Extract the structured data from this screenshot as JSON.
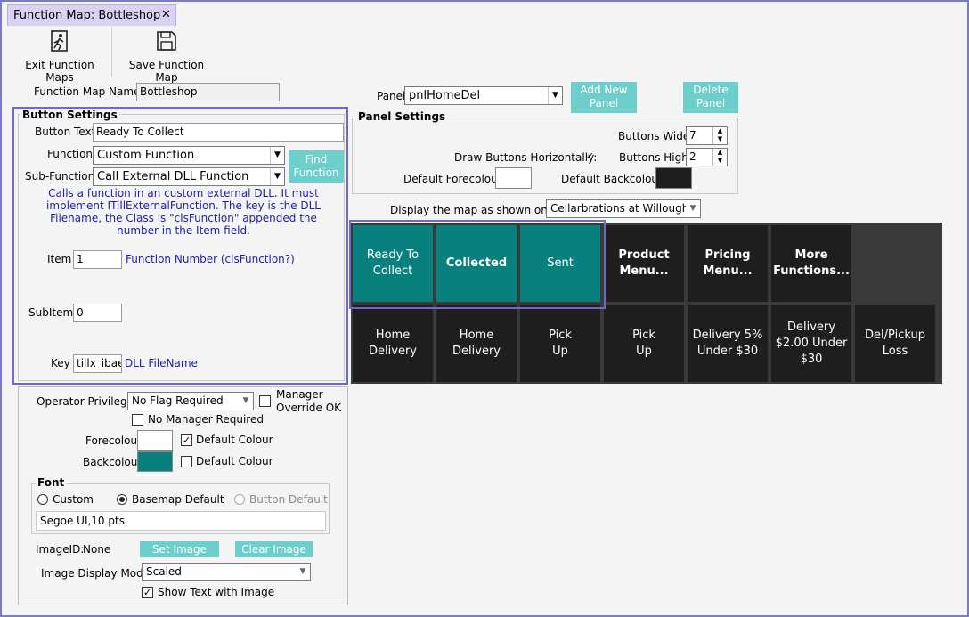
{
  "tab": {
    "title": "Function Map: Bottleshop",
    "close": "✕"
  },
  "toolbar": {
    "exit_label": "Exit Function Maps",
    "save_label": "Save Function Map"
  },
  "function_map_name": {
    "label": "Function Map Name:",
    "value": "Bottleshop"
  },
  "panel": {
    "label": "Panel",
    "value": "pnlHomeDel",
    "add_button": "Add New\nPanel",
    "delete_button": "Delete\nPanel"
  },
  "panel_settings": {
    "title": "Panel Settings",
    "buttons_wide_label": "Buttons Wide:",
    "buttons_wide": "7",
    "buttons_high_label": "Buttons High:",
    "buttons_high": "2",
    "draw_horiz_label": "Draw Buttons Horizontally:",
    "draw_horiz_checked": true,
    "forecolour_label": "Default Forecolour",
    "backcolour_label": "Default Backcolour",
    "forecolour": "#ffffff",
    "backcolour": "#1e1e1e"
  },
  "display_map": {
    "label": "Display the map as shown on till:",
    "value": "Cellarbrations at Willoughb"
  },
  "button_settings": {
    "title": "Button Settings",
    "button_text_label": "Button Text",
    "button_text": "Ready To Collect",
    "function_label": "Function",
    "function_value": "Custom Function",
    "subfunction_label": "Sub-Function",
    "subfunction_value": "Call External DLL Function",
    "find_button": "Find\nFunction",
    "description": "Calls a function in an custom external DLL. It must implement ITillExternalFunction. The key is the DLL Filename, the Class is \"clsFunction\" appended the number in the Item field.",
    "item_label": "Item",
    "item_value": "1",
    "item_hint": "Function Number (clsFunction?)",
    "subitem_label": "SubItem",
    "subitem_value": "0",
    "key_label": "Key",
    "key_value": "tillx_ibaec",
    "key_hint": "DLL FileName"
  },
  "operator": {
    "label": "Operator Privilege:",
    "value": "No Flag Required",
    "manager_override": "Manager\nOverride OK",
    "no_manager": "No Manager Required"
  },
  "colours": {
    "forecolour_label": "Forecolour",
    "backcolour_label": "Backcolour",
    "default_colour": "Default Colour",
    "forecolour": "#ffffff",
    "backcolour": "#08807d",
    "fore_default_checked": true,
    "back_default_checked": false
  },
  "font": {
    "title": "Font",
    "custom": "Custom",
    "basemap": "Basemap Default",
    "button_default": "Button Default",
    "selected": "basemap",
    "value": "Segoe UI,10 pts"
  },
  "image": {
    "id_label": "ImageID:",
    "id_value": "None",
    "set_button": "Set Image",
    "clear_button": "Clear Image",
    "mode_label": "Image Display Mode:",
    "mode_value": "Scaled",
    "show_text": "Show Text with Image"
  },
  "buttons": [
    {
      "label": "Ready To\nCollect",
      "style": "teal"
    },
    {
      "label": "Collected",
      "style": "teal-bold"
    },
    {
      "label": "Sent",
      "style": "teal"
    },
    {
      "label": "Product\nMenu...",
      "style": "dark-bold"
    },
    {
      "label": "Pricing\nMenu...",
      "style": "dark-bold"
    },
    {
      "label": "More\nFunctions...",
      "style": "dark-bold"
    },
    {
      "label": "Home\nDelivery",
      "style": "dark"
    },
    {
      "label": "Home\nDelivery",
      "style": "dark"
    },
    {
      "label": "Pick\nUp",
      "style": "dark"
    },
    {
      "label": "Pick\nUp",
      "style": "dark"
    },
    {
      "label": "Delivery 5%\nUnder $30",
      "style": "dark"
    },
    {
      "label": "Delivery\n$2.00 Under\n$30",
      "style": "dark"
    },
    {
      "label": "Del/Pickup\nLoss",
      "style": "dark"
    }
  ]
}
